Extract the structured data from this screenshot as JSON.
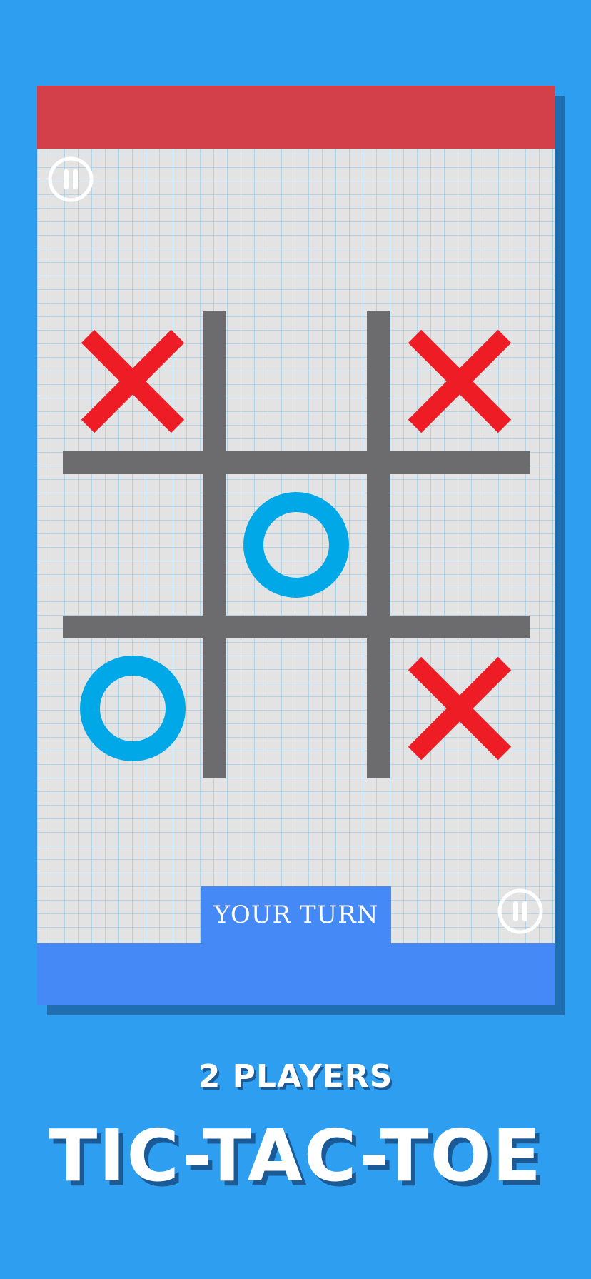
{
  "colors": {
    "background": "#2e9ff0",
    "top_bar": "#d4404a",
    "bottom_bar": "#4589f7",
    "x_mark": "#ee1c25",
    "o_mark": "#00a8e8",
    "grid_lines": "#6c6c6e"
  },
  "game": {
    "status": "YOUR TURN",
    "board": [
      [
        "X",
        "",
        "X"
      ],
      [
        "",
        "O",
        ""
      ],
      [
        "O",
        "",
        "X"
      ]
    ]
  },
  "icons": {
    "pause_top": "pause-icon",
    "pause_bottom": "pause-icon"
  },
  "footer": {
    "subtitle": "2 PLAYERS",
    "title": "TIC-TAC-TOE"
  }
}
